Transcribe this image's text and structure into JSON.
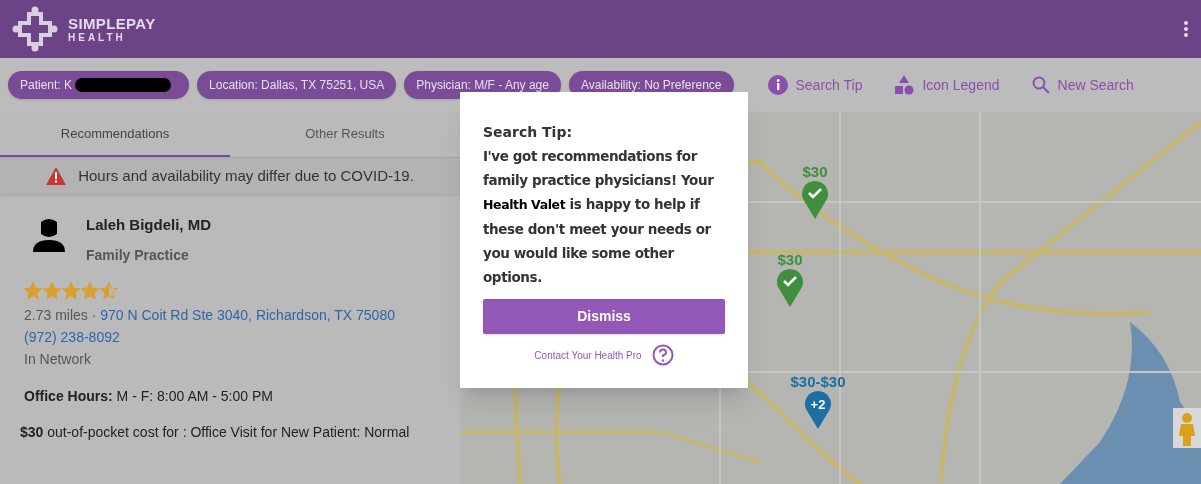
{
  "header": {
    "logo_title": "SIMPLEPAY",
    "logo_subtitle": "HEALTH"
  },
  "filters": [
    {
      "label": "Patient: K",
      "redacted": true
    },
    {
      "label": "Location: Dallas, TX 75251, USA",
      "redacted": false
    },
    {
      "label": "Physician: M/F - Any age",
      "redacted": false
    },
    {
      "label": "Availability: No Preference",
      "redacted": false
    }
  ],
  "actions": [
    {
      "kind": "info",
      "label": "Search Tip"
    },
    {
      "kind": "legend",
      "label": "Icon Legend"
    },
    {
      "kind": "search",
      "label": "New Search"
    }
  ],
  "tabs": [
    {
      "label": "Recommendations",
      "selected": true
    },
    {
      "label": "Other Results",
      "selected": false
    }
  ],
  "notice": "Hours and availability may differ due to COVID-19.",
  "provider": {
    "name": "Laleh Bigdeli, MD",
    "specialty": "Family Practice",
    "stars": 4.5,
    "distance": "2.73 miles ·",
    "address": "970 N Coit Rd Ste 3040, Richardson, TX 75080",
    "phone": "(972) 238-8092",
    "network": "In Network",
    "hours": "**Office Hours:** M - F: 8:00 AM - 5:00 PM",
    "cost": "**$30** out-of-pocket cost for : Office Visit for New Patient: Normal"
  },
  "map": {
    "markers": [
      {
        "kind": "check",
        "price": "$30",
        "color": "#3f8f3f"
      },
      {
        "kind": "check",
        "price": "$30",
        "color": "#3f8f3f"
      },
      {
        "kind": "cluster",
        "price": "$30-$30",
        "count": "+2",
        "color": "#1a6fa3"
      }
    ]
  },
  "dialog": {
    "title": "Search Tip:",
    "body_start": "I've got recommendations for family practice physicians! Your",
    "highlight": "Health Valet",
    "body_end": "is happy to help if these don't meet your needs or you would like some other options.",
    "button": "Dismiss",
    "link": "Contact Your Health Pro"
  }
}
